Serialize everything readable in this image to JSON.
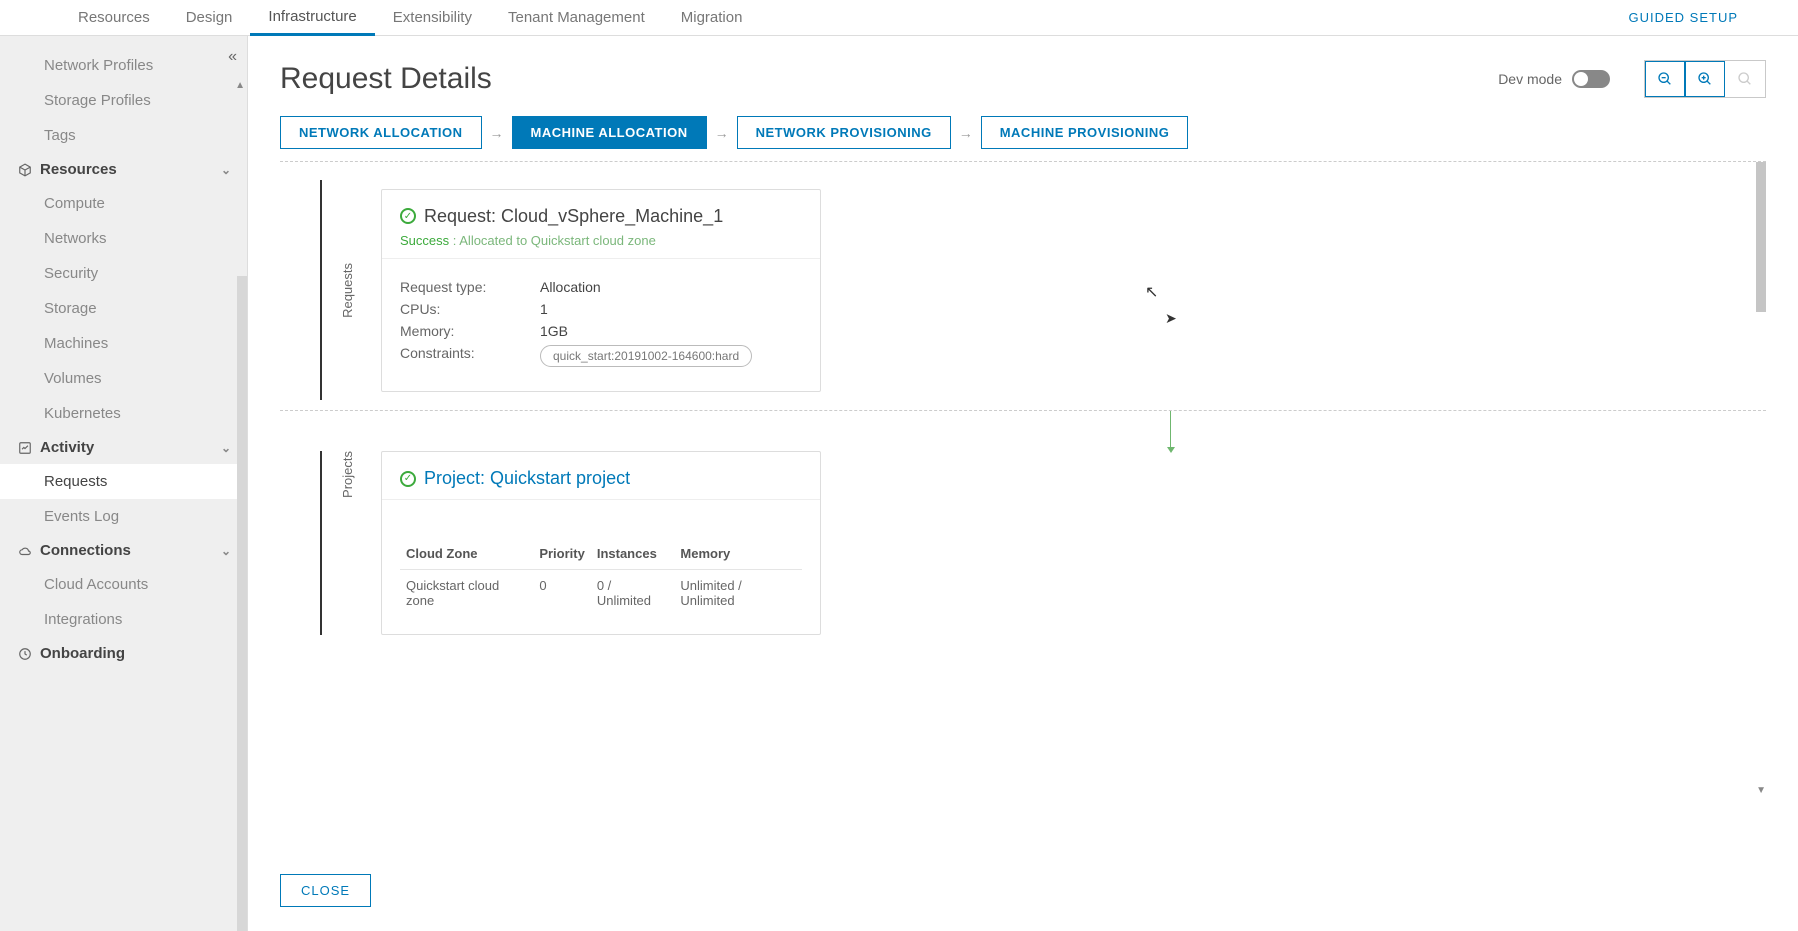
{
  "topnav": {
    "items": [
      "Resources",
      "Design",
      "Infrastructure",
      "Extensibility",
      "Tenant Management",
      "Migration"
    ],
    "activeIndex": 2,
    "rightLink": "GUIDED SETUP"
  },
  "sidebar": {
    "preItems": [
      "Network Profiles",
      "Storage Profiles",
      "Tags"
    ],
    "sections": [
      {
        "label": "Resources",
        "icon": "cube-icon",
        "items": [
          "Compute",
          "Networks",
          "Security",
          "Storage",
          "Machines",
          "Volumes",
          "Kubernetes"
        ]
      },
      {
        "label": "Activity",
        "icon": "activity-icon",
        "items": [
          "Requests",
          "Events Log"
        ],
        "activeItemIndex": 0
      },
      {
        "label": "Connections",
        "icon": "cloud-icon",
        "items": [
          "Cloud Accounts",
          "Integrations"
        ]
      },
      {
        "label": "Onboarding",
        "icon": "onboarding-icon",
        "items": []
      }
    ]
  },
  "page": {
    "title": "Request Details",
    "devModeLabel": "Dev mode",
    "closeLabel": "CLOSE"
  },
  "steps": {
    "items": [
      "NETWORK ALLOCATION",
      "MACHINE ALLOCATION",
      "NETWORK PROVISIONING",
      "MACHINE PROVISIONING"
    ],
    "activeIndex": 1
  },
  "requestCard": {
    "railLabel": "Requests",
    "titlePrefix": "Request: ",
    "titleValue": "Cloud_vSphere_Machine_1",
    "statusLabel": "Success",
    "statusText": " : Allocated to Quickstart cloud zone",
    "rows": [
      {
        "label": "Request type:",
        "value": "Allocation"
      },
      {
        "label": "CPUs:",
        "value": "1"
      },
      {
        "label": "Memory:",
        "value": "1GB"
      }
    ],
    "constraintsLabel": "Constraints:",
    "constraintPill": "quick_start:20191002-164600:hard"
  },
  "projectCard": {
    "railLabel": "Projects",
    "titlePrefix": "Project: ",
    "titleValue": "Quickstart project",
    "table": {
      "headers": [
        "Cloud Zone",
        "Priority",
        "Instances",
        "Memory"
      ],
      "row": {
        "zone": "Quickstart cloud zone",
        "priority": "0",
        "instances": "0 / Unlimited",
        "memory": "Unlimited / Unlimited"
      }
    }
  }
}
